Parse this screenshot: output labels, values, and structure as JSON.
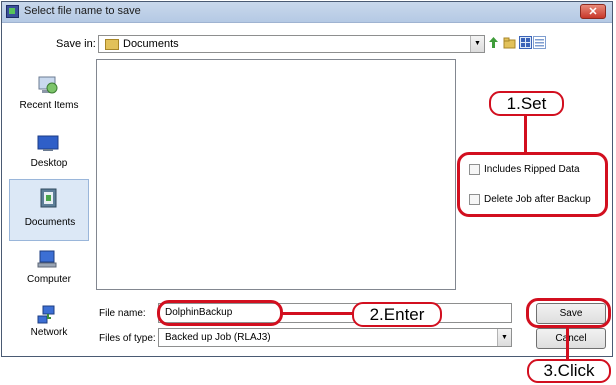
{
  "dialog": {
    "title": "Select file name to save",
    "close_glyph": "✕",
    "save_in_label": "Save in:",
    "save_in_value": "Documents",
    "dropdown_arrow": "▼"
  },
  "toolbar": {
    "icons": [
      "up-folder-icon",
      "new-folder-icon",
      "view-menu-icon"
    ]
  },
  "places": [
    {
      "label": "Recent Items",
      "icon": "recent-items-icon",
      "active": false
    },
    {
      "label": "Desktop",
      "icon": "desktop-icon",
      "active": false
    },
    {
      "label": "Documents",
      "icon": "documents-icon",
      "active": true
    },
    {
      "label": "Computer",
      "icon": "computer-icon",
      "active": false
    },
    {
      "label": "Network",
      "icon": "network-icon",
      "active": false
    }
  ],
  "options": {
    "includes_ripped": {
      "label": "Includes Ripped Data",
      "checked": false
    },
    "delete_after_backup": {
      "label": "Delete Job after Backup",
      "checked": false
    }
  },
  "file_name": {
    "label": "File name:",
    "value": "DolphinBackup"
  },
  "file_type": {
    "label": "Files of type:",
    "value": "Backed up Job (RLAJ3)"
  },
  "buttons": {
    "save": "Save",
    "cancel": "Cancel"
  },
  "callouts": {
    "set": "1.Set",
    "enter": "2.Enter",
    "click": "3.Click"
  },
  "colors": {
    "callout": "#d20f1f",
    "selection": "#dce8f6"
  }
}
